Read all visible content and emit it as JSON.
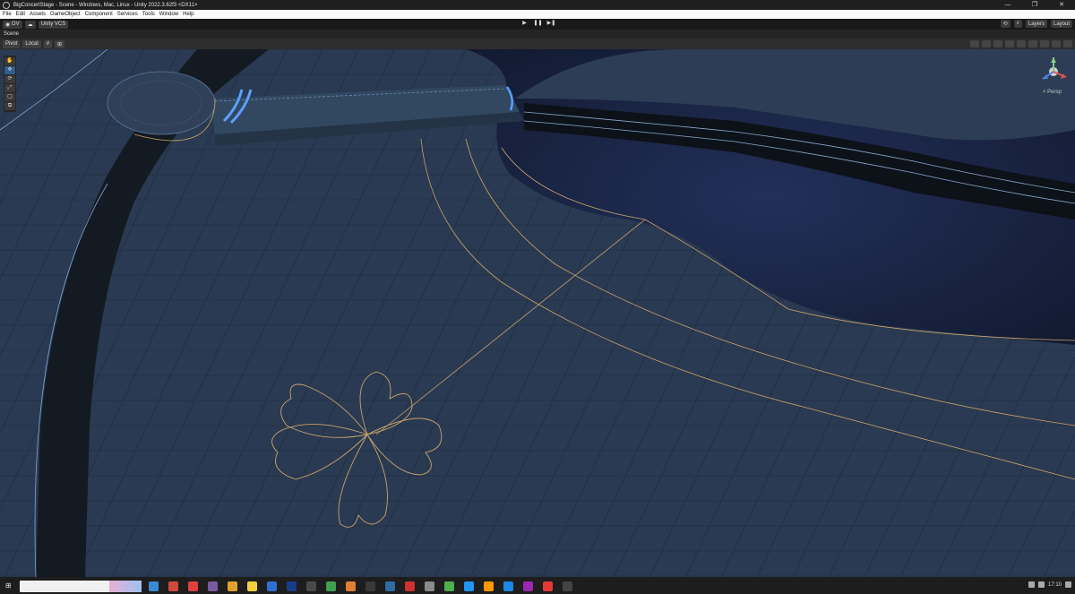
{
  "window": {
    "title": "BigConcertStage - Scene - Windows, Mac, Linux - Unity 2022.3.62f3 <DX11>",
    "controls": [
      "—",
      "❐",
      "✕"
    ]
  },
  "menu": [
    "File",
    "Edit",
    "Assets",
    "GameObject",
    "Component",
    "Services",
    "Tools",
    "Window",
    "Help"
  ],
  "toolbar": {
    "account_label": "OV",
    "vcs_label": "Unity VCS",
    "play": [
      "▶",
      "❚❚",
      "▶❚"
    ],
    "layers_label": "Layers",
    "layout_label": "Layout"
  },
  "tab": {
    "label": "Scene"
  },
  "scene_toolbar": {
    "pivot_label": "Pivot",
    "local_label": "Local"
  },
  "tools": [
    "✋",
    "✥",
    "⟳",
    "⤢",
    "▢",
    "⧉"
  ],
  "gizmo": {
    "label": "< Persp"
  },
  "taskbar": {
    "clock": "17:10",
    "icon_colors": [
      "#3a8ad6",
      "#d04a3a",
      "#e04040",
      "#7a5aa0",
      "#e0a030",
      "#f0d040",
      "#2f6fd0",
      "#1a3d8a",
      "#4a4a4a",
      "#40a050",
      "#e08030",
      "#3a3a3a",
      "#2e6da4",
      "#d03030",
      "#8a8a8a",
      "#4caf50",
      "#2196f3",
      "#ff9800",
      "#1e88e5",
      "#9c27b0",
      "#e53935",
      "#444444"
    ]
  },
  "colors": {
    "floor": "#2a3a52",
    "accent_lines": "#c9a46a",
    "blue_glow": "#5aa0ff",
    "starfield": "#1a2444"
  }
}
